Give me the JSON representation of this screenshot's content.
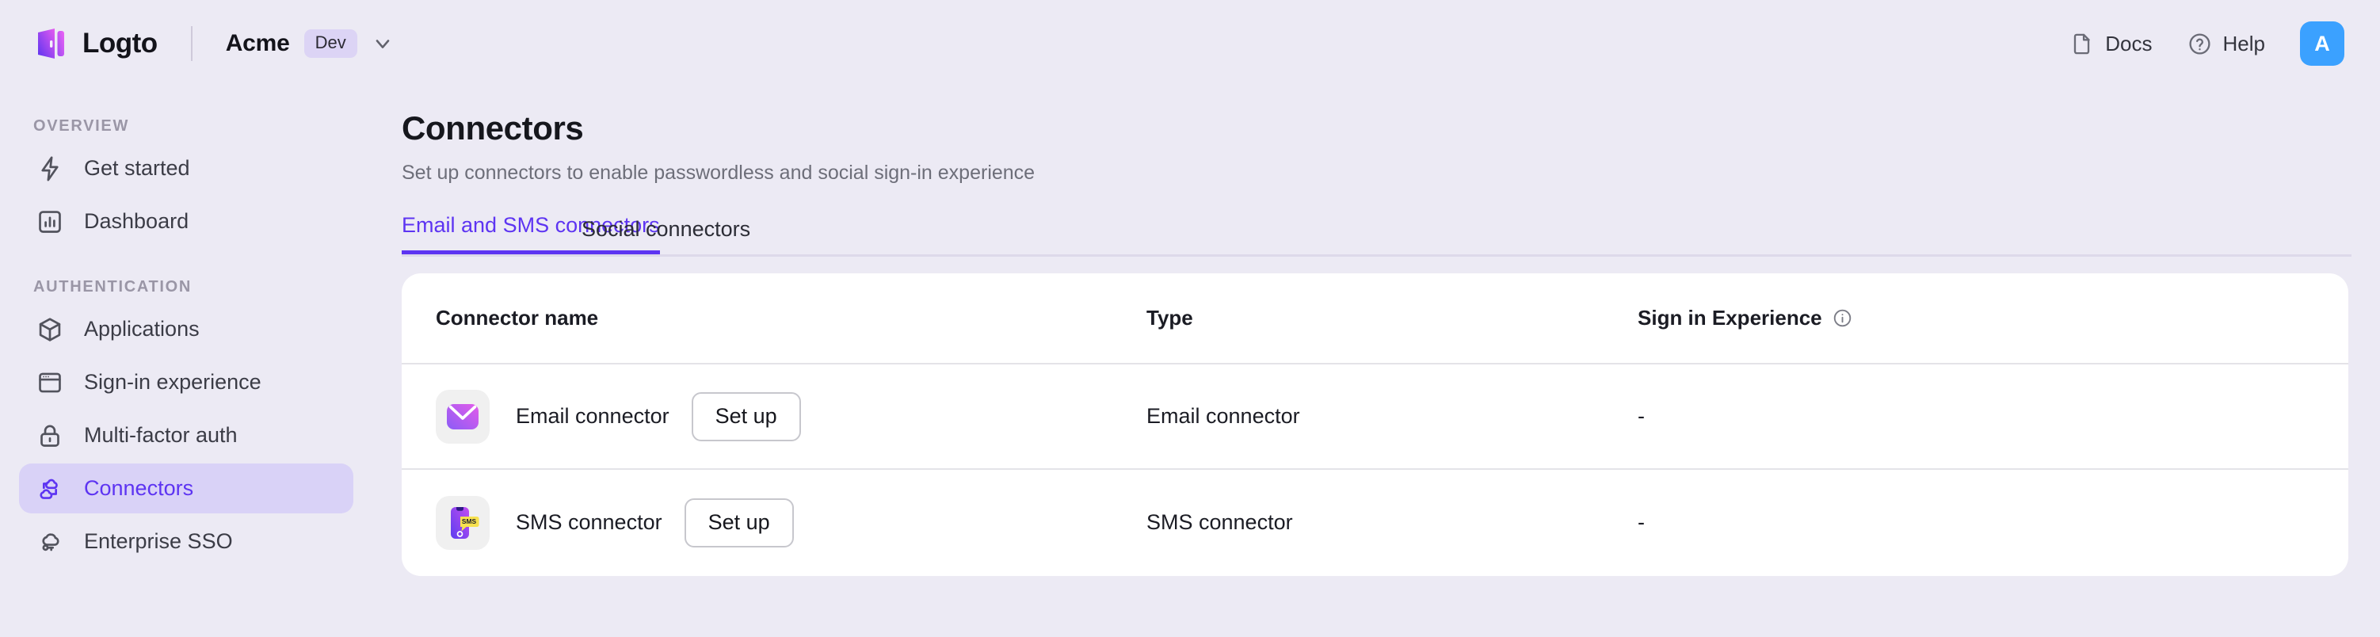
{
  "header": {
    "brand_name": "Logto",
    "brand_logo_icon": "logto-logo-icon",
    "tenant_name": "Acme",
    "tenant_badge": "Dev",
    "tenant_caret_icon": "chevron-down-icon",
    "docs_label": "Docs",
    "docs_icon": "document-icon",
    "help_label": "Help",
    "help_icon": "question-circle-icon",
    "avatar_initial": "A",
    "avatar_color": "#3ba1ff"
  },
  "sidebar": {
    "sections": [
      {
        "title": "OVERVIEW",
        "items": [
          {
            "label": "Get started",
            "icon": "lightning-bolt-icon",
            "active": false
          },
          {
            "label": "Dashboard",
            "icon": "bar-chart-icon",
            "active": false
          }
        ]
      },
      {
        "title": "AUTHENTICATION",
        "items": [
          {
            "label": "Applications",
            "icon": "cube-icon",
            "active": false
          },
          {
            "label": "Sign-in experience",
            "icon": "browser-window-icon",
            "active": false
          },
          {
            "label": "Multi-factor auth",
            "icon": "lock-icon",
            "active": false
          },
          {
            "label": "Connectors",
            "icon": "connectors-cloud-icon",
            "active": true
          },
          {
            "label": "Enterprise SSO",
            "icon": "cloud-key-icon",
            "active": false
          }
        ]
      }
    ],
    "active_color": "#5d34f2",
    "active_bg": "#d9d2f7"
  },
  "main": {
    "title": "Connectors",
    "subtitle": "Set up connectors to enable passwordless and social sign-in experience",
    "tabs": [
      {
        "label": "Email and SMS connectors",
        "active": true
      },
      {
        "label": "Social connectors",
        "active": false
      }
    ],
    "table": {
      "columns": [
        "Connector name",
        "Type",
        "Sign in Experience"
      ],
      "sign_in_experience_info_icon": "info-icon",
      "rows": [
        {
          "logo_icon": "email-envelope-icon",
          "name": "Email connector",
          "action_label": "Set up",
          "type": "Email connector",
          "sign_in_experience": "-"
        },
        {
          "logo_icon": "sms-phone-icon",
          "name": "SMS connector",
          "action_label": "Set up",
          "type": "SMS connector",
          "sign_in_experience": "-"
        }
      ]
    }
  },
  "colors": {
    "background": "#eceaf4",
    "card": "#ffffff",
    "accent": "#5d34f2"
  }
}
